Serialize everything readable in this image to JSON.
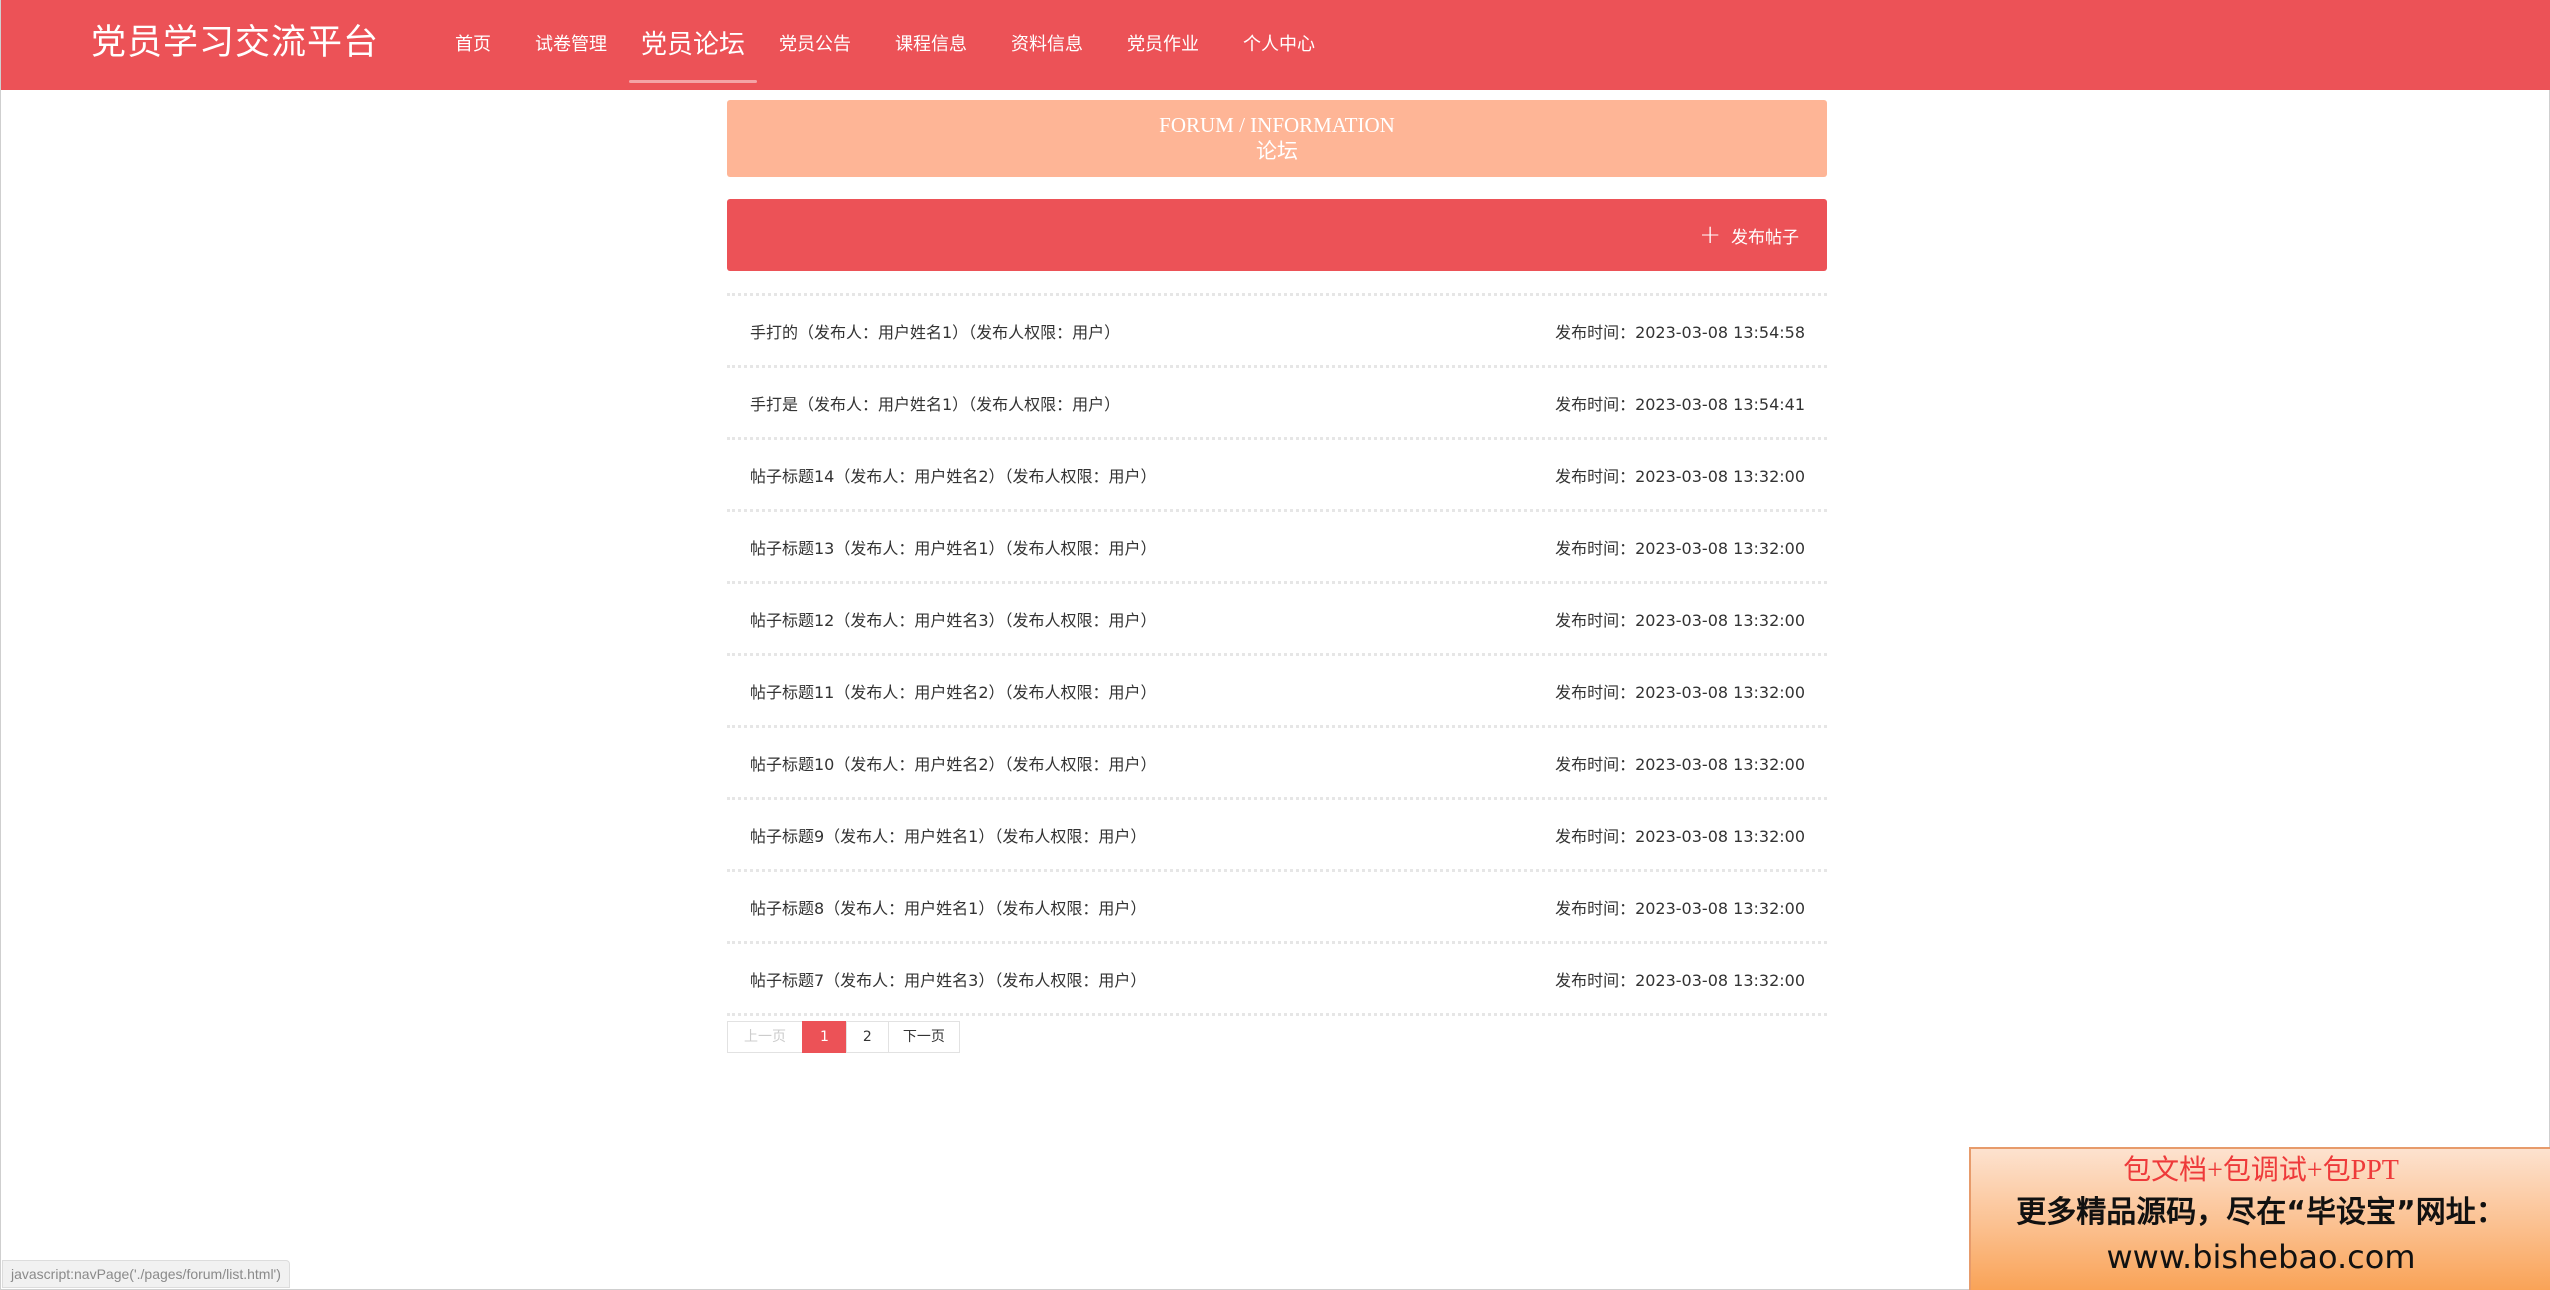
{
  "header": {
    "site_title": "党员学习交流平台",
    "nav": [
      {
        "label": "首页",
        "active": false
      },
      {
        "label": "试卷管理",
        "active": false
      },
      {
        "label": "党员论坛",
        "active": true
      },
      {
        "label": "党员公告",
        "active": false
      },
      {
        "label": "课程信息",
        "active": false
      },
      {
        "label": "资料信息",
        "active": false
      },
      {
        "label": "党员作业",
        "active": false
      },
      {
        "label": "个人中心",
        "active": false
      }
    ]
  },
  "banner": {
    "en": "FORUM / INFORMATION",
    "cn": "论坛"
  },
  "actions": {
    "publish_label": "发布帖子",
    "publish_icon": "plus-icon"
  },
  "posts": [
    {
      "title": "手打的（发布人：用户姓名1）（发布人权限：用户）",
      "time": "发布时间：2023-03-08 13:54:58"
    },
    {
      "title": "手打是（发布人：用户姓名1）（发布人权限：用户）",
      "time": "发布时间：2023-03-08 13:54:41"
    },
    {
      "title": "帖子标题14（发布人：用户姓名2）（发布人权限：用户）",
      "time": "发布时间：2023-03-08 13:32:00"
    },
    {
      "title": "帖子标题13（发布人：用户姓名1）（发布人权限：用户）",
      "time": "发布时间：2023-03-08 13:32:00"
    },
    {
      "title": "帖子标题12（发布人：用户姓名3）（发布人权限：用户）",
      "time": "发布时间：2023-03-08 13:32:00"
    },
    {
      "title": "帖子标题11（发布人：用户姓名2）（发布人权限：用户）",
      "time": "发布时间：2023-03-08 13:32:00"
    },
    {
      "title": "帖子标题10（发布人：用户姓名2）（发布人权限：用户）",
      "time": "发布时间：2023-03-08 13:32:00"
    },
    {
      "title": "帖子标题9（发布人：用户姓名1）（发布人权限：用户）",
      "time": "发布时间：2023-03-08 13:32:00"
    },
    {
      "title": "帖子标题8（发布人：用户姓名1）（发布人权限：用户）",
      "time": "发布时间：2023-03-08 13:32:00"
    },
    {
      "title": "帖子标题7（发布人：用户姓名3）（发布人权限：用户）",
      "time": "发布时间：2023-03-08 13:32:00"
    }
  ],
  "pagination": {
    "prev_label": "上一页",
    "pages": [
      "1",
      "2"
    ],
    "current": "1",
    "next_label": "下一页"
  },
  "status_bar": {
    "text": "javascript:navPage('./pages/forum/list.html')"
  },
  "watermark": {
    "line1": "包文档+包调试+包PPT",
    "line2": "更多精品源码，尽在“毕设宝”网址：",
    "line3": "www.bishebao.com"
  },
  "colors": {
    "primary": "#ec5257",
    "banner": "#feb596"
  }
}
